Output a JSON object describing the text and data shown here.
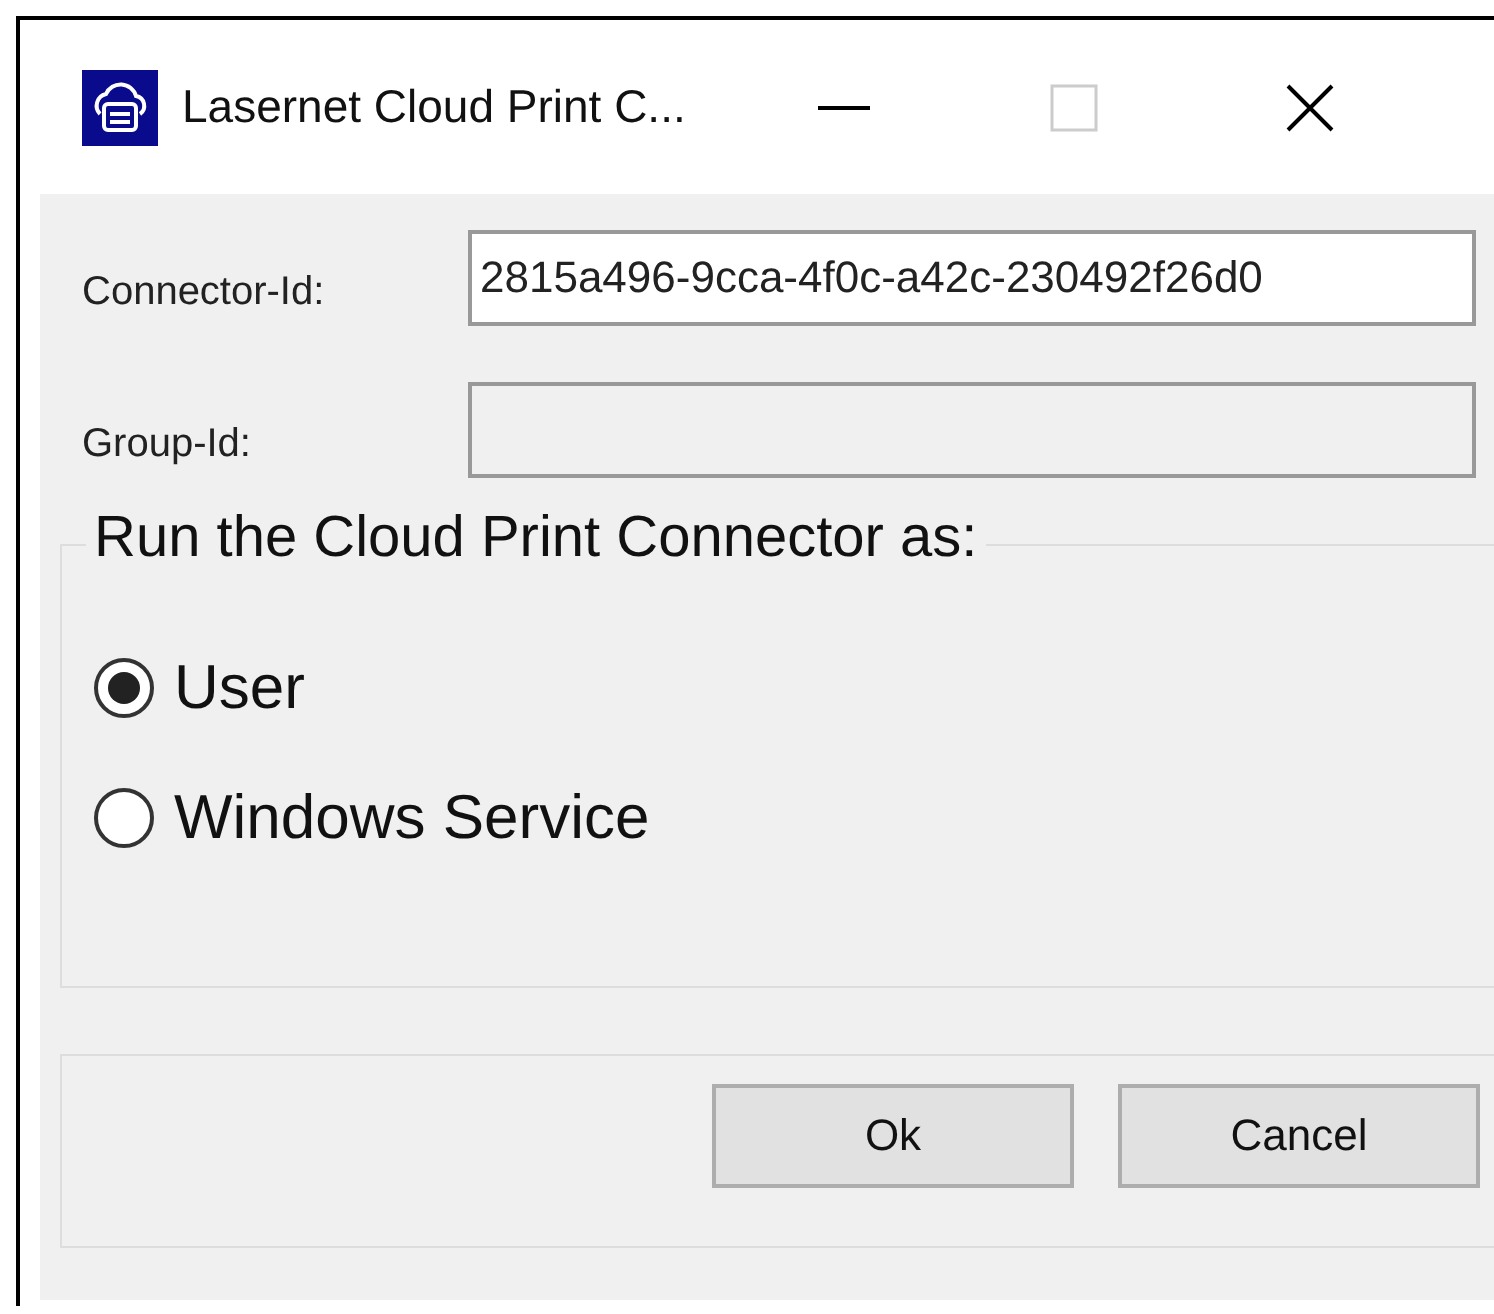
{
  "window": {
    "title": "Lasernet Cloud Print C...",
    "maximize_disabled": true
  },
  "fields": [
    {
      "label": "Connector-Id:",
      "value": "2815a496-9cca-4f0c-a42c-230492f26d0",
      "disabled": false
    },
    {
      "label": "Group-Id:",
      "disabled": true
    }
  ],
  "run_as": {
    "legend": "Run the Cloud Print Connector as:",
    "options": [
      {
        "label": "User",
        "selected": true
      },
      {
        "label": "Windows Service",
        "selected": false
      }
    ]
  },
  "buttons": [
    "Ok",
    "Cancel"
  ]
}
